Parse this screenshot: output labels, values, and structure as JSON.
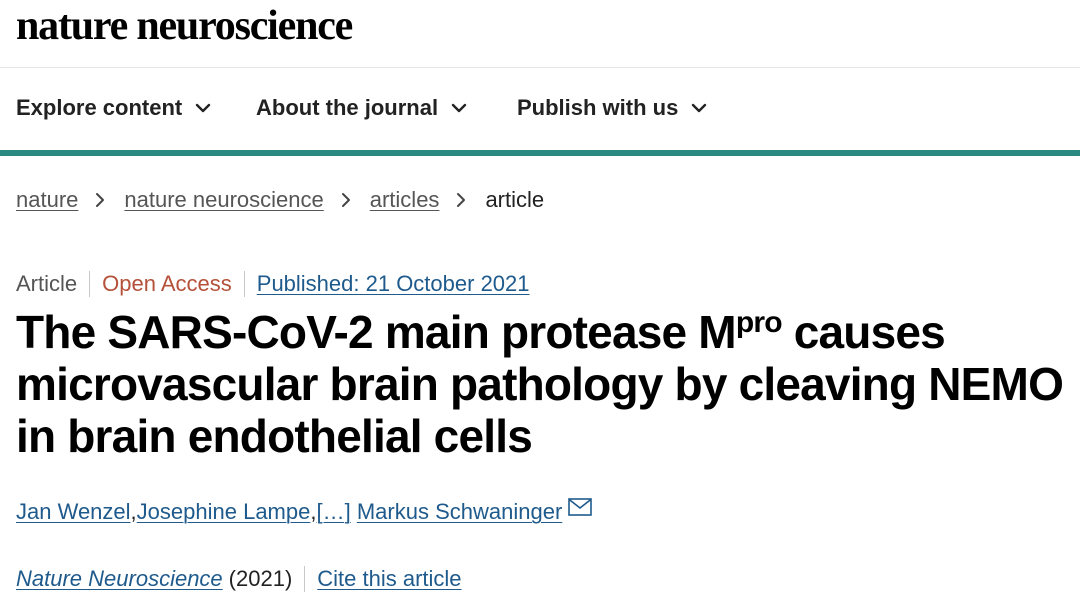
{
  "site": {
    "logo_text": "nature neuroscience"
  },
  "nav": {
    "items": [
      {
        "label": "Explore content",
        "icon": "chevron-down-icon"
      },
      {
        "label": "About the journal",
        "icon": "chevron-down-icon"
      },
      {
        "label": "Publish with us",
        "icon": "chevron-down-icon"
      }
    ],
    "accent_color": "#2a8a80"
  },
  "breadcrumb": {
    "links": [
      "nature",
      "nature neuroscience",
      "articles"
    ],
    "current": "article",
    "separator_icon": "chevron-right-icon"
  },
  "article": {
    "type": "Article",
    "access": "Open Access",
    "access_color": "#b5513a",
    "published": "Published: 21 October 2021",
    "title_part1": "The SARS-CoV-2 main protease M",
    "title_sup": "pro",
    "title_part2": " causes microvascular brain pathology by cleaving NEMO in brain endothelial cells",
    "authors": [
      "Jan Wenzel",
      "Josephine Lampe",
      "[…]",
      "Markus Schwaninger"
    ],
    "author_separator": ", ",
    "contact_icon": "mail-icon",
    "journal": "Nature Neuroscience",
    "year": "(2021)",
    "cite_label": "Cite this article",
    "link_color": "#1f5a8c"
  }
}
